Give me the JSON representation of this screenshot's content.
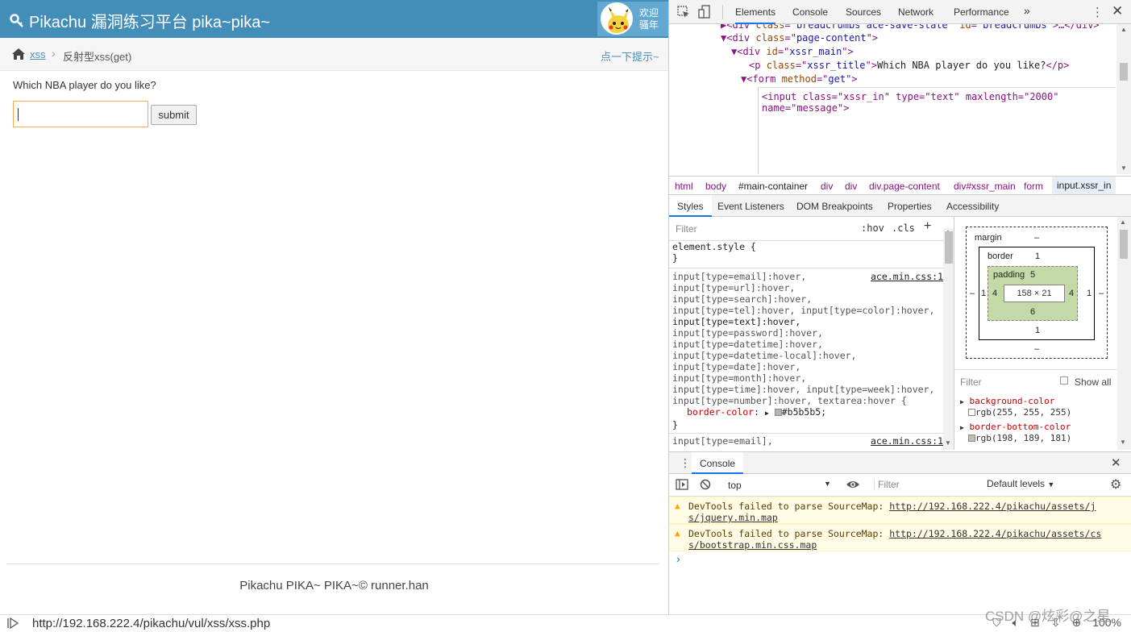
{
  "site": {
    "title": "Pikachu 漏洞练习平台 pika~pika~",
    "welcome_line1": "欢迎",
    "welcome_line2": "骚年"
  },
  "breadcrumbs": {
    "link": "xss",
    "separator": "›",
    "current": "反射型xss(get)",
    "hint": "点一下提示~"
  },
  "main": {
    "question": "Which NBA player do you like?",
    "input_value": "",
    "submit_label": "submit"
  },
  "footer": {
    "text": "Pikachu PIKA~ PIKA~© runner.han"
  },
  "statusbar": {
    "url": "http://192.168.222.4/pikachu/vul/xss/xss.php",
    "zoom": "100%",
    "watermark": "CSDN @炫彩@之星"
  },
  "devtools": {
    "tabs": [
      "Elements",
      "Console",
      "Sources",
      "Network",
      "Performance",
      "»"
    ],
    "active_tab": "Elements",
    "tree": [
      {
        "indent": 0,
        "text": "▶<div class=\"breadcrumbs ace-save-state\" id=\"breadcrumbs\">…</div>"
      },
      {
        "indent": 0,
        "text": "▼<div class=\"page-content\">"
      },
      {
        "indent": 1,
        "text": "▼<div id=\"xssr_main\">"
      },
      {
        "indent": 2,
        "text": "<p class=\"xssr_title\">Which NBA player do you like?</p>"
      },
      {
        "indent": 2,
        "text": "▼<form method=\"get\">"
      }
    ],
    "edit_line1": "<input class=\"xssr_in\" type=\"text\" maxlength=\"2000\"",
    "edit_line2": "name=\"message\">",
    "crumbs": [
      "html",
      "body",
      "#main-container",
      "div",
      "div",
      "div.page-content",
      "div#xssr_main",
      "form",
      "input.xssr_in"
    ],
    "sub_tabs": [
      "Styles",
      "Event Listeners",
      "DOM Breakpoints",
      "Properties",
      "Accessibility"
    ],
    "styles": {
      "filter_placeholder": "Filter",
      "hov": ":hov",
      "cls": ".cls",
      "plus": "+",
      "element_style": "element.style {",
      "close_brace": "}",
      "rule1_selectors": [
        "input[type=email]:hover,",
        "input[type=url]:hover,",
        "input[type=search]:hover,",
        "input[type=tel]:hover, input[type=color]:hover,",
        "input[type=text]:hover,",
        "input[type=password]:hover,",
        "input[type=datetime]:hover,",
        "input[type=datetime-local]:hover,",
        "input[type=date]:hover,",
        "input[type=month]:hover,",
        "input[type=time]:hover, input[type=week]:hover,",
        "input[type=number]:hover, textarea:hover {"
      ],
      "rule1_source": "ace.min.css:1",
      "rule1_prop": "border-color",
      "rule1_value": "#b5b5b5;",
      "rule1_swatch": "#b5b5b5",
      "rule2_selector": "input[type=email],",
      "rule2_source": "ace.min.css:1"
    },
    "boxmodel": {
      "margin_label": "margin",
      "margin_top": "–",
      "margin_bottom": "–",
      "margin_left": "–",
      "margin_right": "–",
      "border_label": "border",
      "border_top": "1",
      "border_bottom": "1",
      "border_left": "1",
      "border_right": "1",
      "padding_label": "padding",
      "padding_top": "5",
      "padding_bottom": "6",
      "padding_left": "4",
      "padding_right": "4",
      "content": "158 × 21"
    },
    "computed": {
      "filter_placeholder": "Filter",
      "show_all": "Show all",
      "props": [
        {
          "name": "background-color",
          "value": "rgb(255, 255, 255)",
          "swatch": "#ffffff"
        },
        {
          "name": "border-bottom-color",
          "value": "rgb(198, 189, 181)",
          "swatch": "#c6bdb5"
        }
      ]
    },
    "console": {
      "title": "Console",
      "context": "top",
      "filter_placeholder": "Filter",
      "levels": "Default levels",
      "messages": [
        {
          "prefix": "DevTools failed to parse SourceMap: ",
          "link1": "http://192.168.222.4/pikachu/assets/j",
          "link2": "s/jquery.min.map"
        },
        {
          "prefix": "DevTools failed to parse SourceMap: ",
          "link1": "http://192.168.222.4/pikachu/assets/cs",
          "link2": "s/bootstrap.min.css.map"
        }
      ],
      "prompt": "›"
    }
  },
  "colors": {
    "navbar": "#438eb9",
    "link": "#4c8fbd",
    "input_focus_border": "#f0ad4e"
  }
}
